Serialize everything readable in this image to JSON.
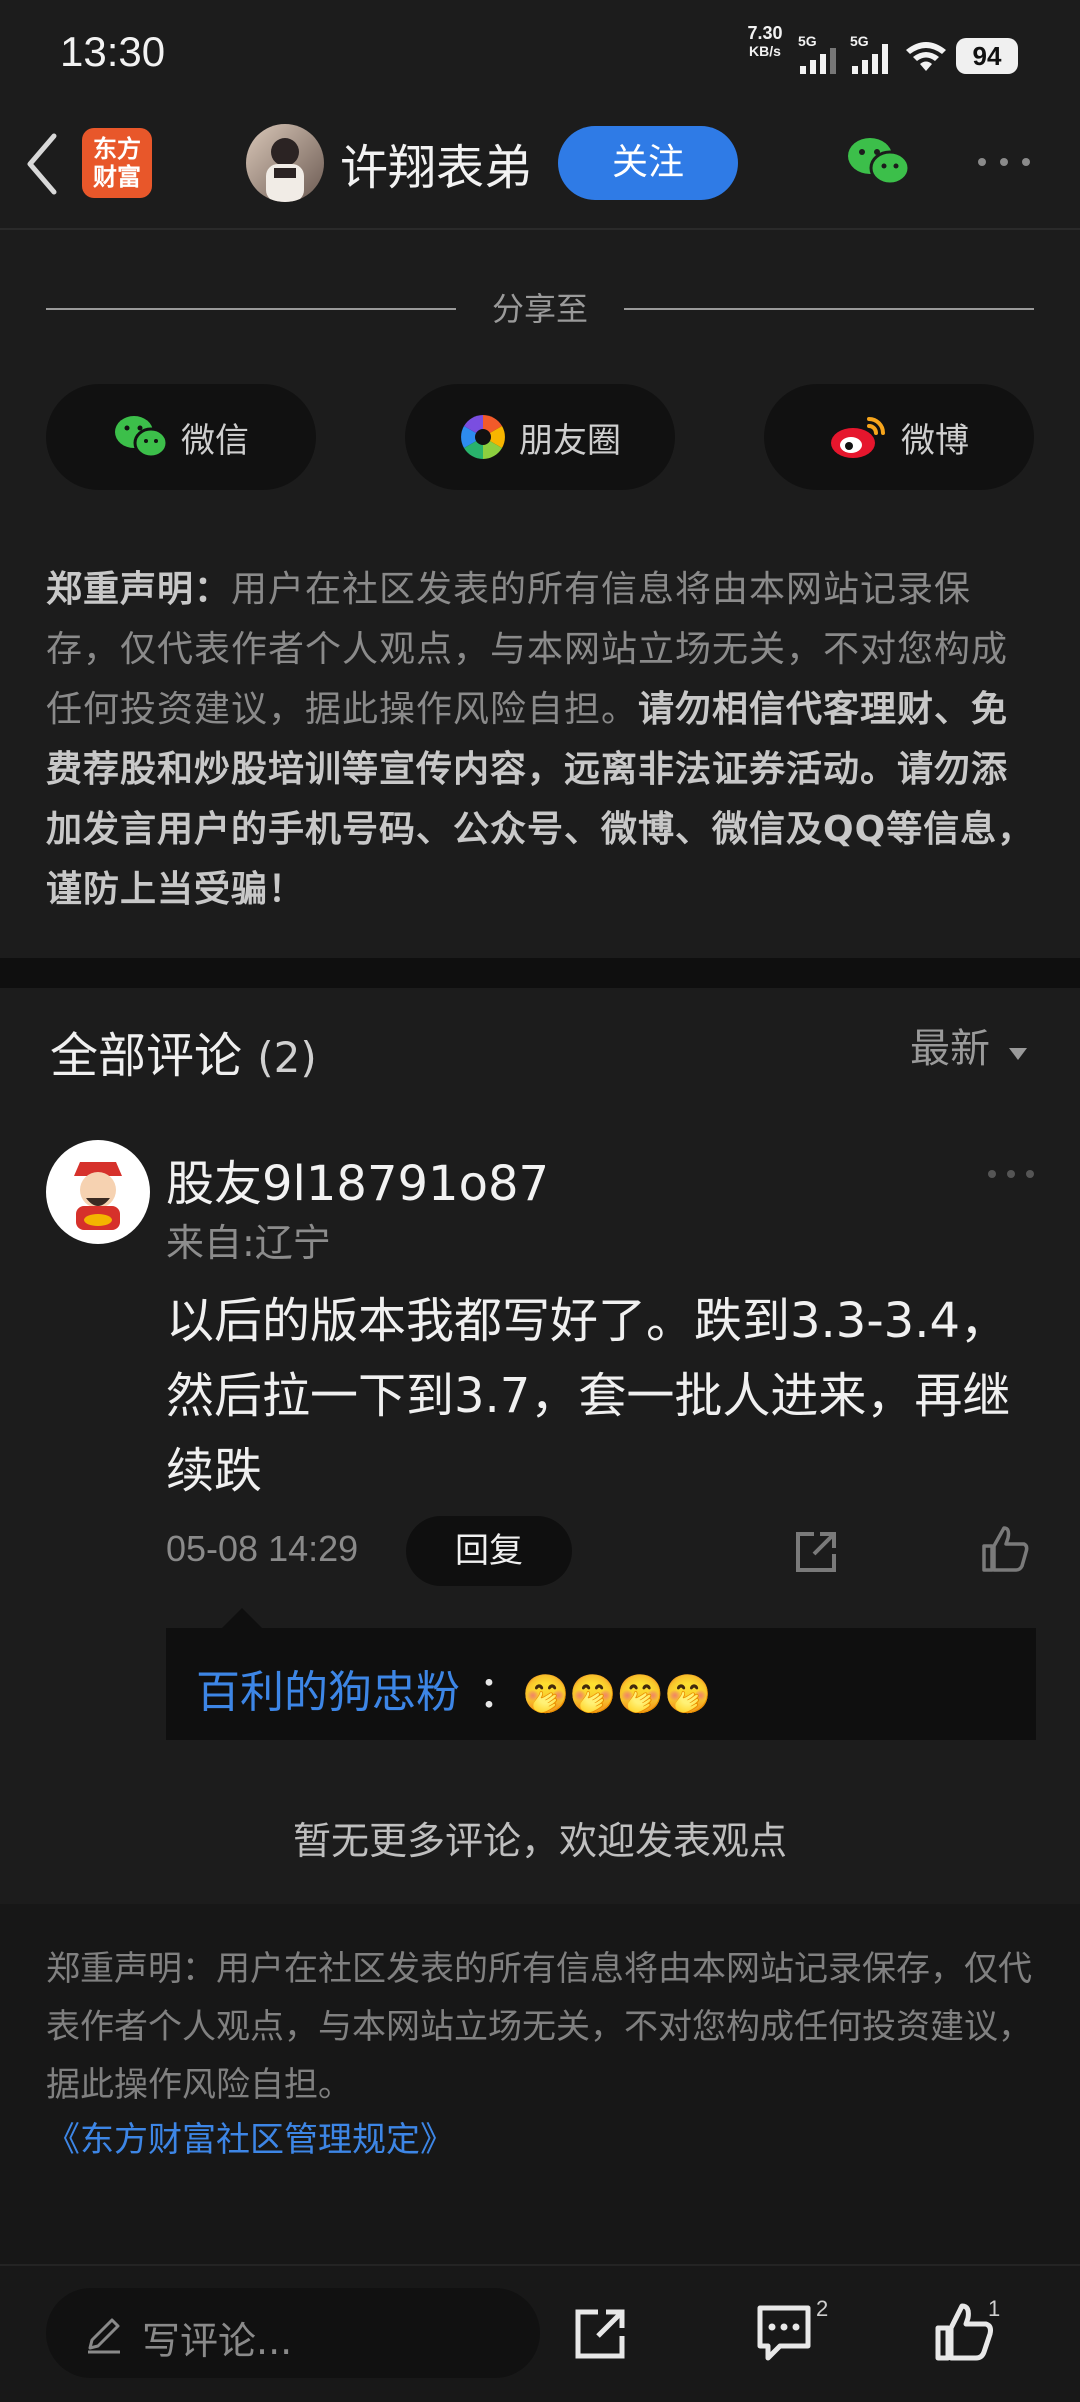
{
  "status_bar": {
    "time": "13:30",
    "net_speed": "7.30",
    "net_unit": "KB/s",
    "signal1_label": "5G",
    "signal2_label": "5G",
    "battery": "94"
  },
  "header": {
    "app_logo_text": "东方财富",
    "username": "许翔表弟",
    "follow_label": "关注"
  },
  "share": {
    "title": "分享至",
    "items": [
      {
        "label": "微信"
      },
      {
        "label": "朋友圈"
      },
      {
        "label": "微博"
      }
    ]
  },
  "disclaimer": {
    "prefix": "郑重声明：",
    "normal": "用户在社区发表的所有信息将由本网站记录保存，仅代表作者个人观点，与本网站立场无关，不对您构成任何投资建议，据此操作风险自担。",
    "bold": "请勿相信代客理财、免费荐股和炒股培训等宣传内容，远离非法证券活动。请勿添加发言用户的手机号码、公众号、微博、微信及QQ等信息，谨防上当受骗！"
  },
  "comments": {
    "title": "全部评论",
    "count": "(2)",
    "sort_label": "最新",
    "items": [
      {
        "username": "股友9l18791o87",
        "location": "来自:辽宁",
        "text": "以后的版本我都写好了。跌到3.3-3.4，然后拉一下到3.7，套一批人进来，再继续跌",
        "time": "05-08 14:29",
        "reply_label": "回复",
        "reply": {
          "user": "百利的狗忠粉",
          "separator": "：",
          "content": "🤭🤭🤭🤭"
        }
      }
    ],
    "no_more": "暂无更多评论，欢迎发表观点"
  },
  "footer": {
    "disclaimer": "郑重声明：用户在社区发表的所有信息将由本网站记录保存，仅代表作者个人观点，与本网站立场无关，不对您构成任何投资建议，据此操作风险自担。",
    "link": "《东方财富社区管理规定》"
  },
  "bottom_bar": {
    "input_placeholder": "写评论...",
    "comment_count": "2",
    "like_count": "1"
  },
  "colors": {
    "background": "#1c1c1c",
    "accent_blue": "#2f7be6",
    "link_blue": "#3d86e6",
    "brand_orange": "#e8572a",
    "wechat_green": "#3cbf4a",
    "weibo_red": "#e6162d"
  }
}
